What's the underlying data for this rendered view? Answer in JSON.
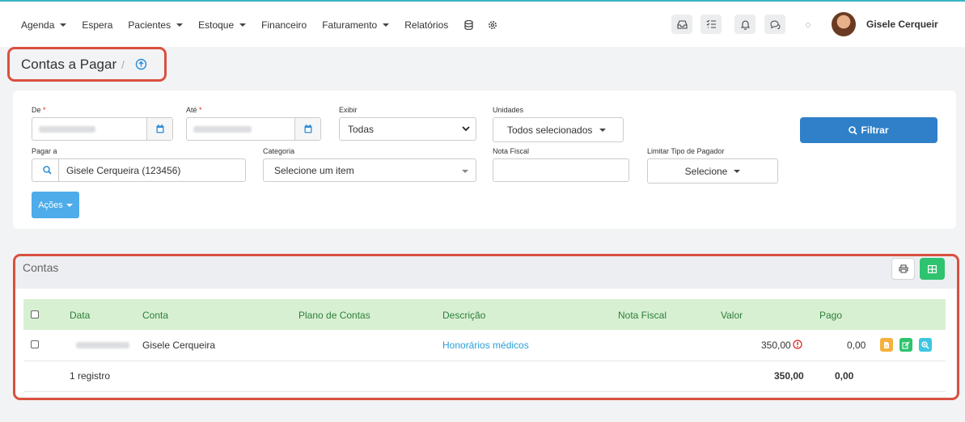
{
  "nav": {
    "items": [
      {
        "label": "Agenda",
        "caret": true
      },
      {
        "label": "Espera",
        "caret": false
      },
      {
        "label": "Pacientes",
        "caret": true
      },
      {
        "label": "Estoque",
        "caret": true
      },
      {
        "label": "Financeiro",
        "caret": false
      },
      {
        "label": "Faturamento",
        "caret": true
      },
      {
        "label": "Relatórios",
        "caret": false
      }
    ],
    "icons": [
      "database-icon",
      "gear-icon"
    ],
    "toolbar_icons": [
      "inbox-icon",
      "checklist-icon",
      "bell-icon",
      "chat-icon"
    ],
    "user_name": "Gisele Cerqueir"
  },
  "breadcrumb": {
    "title": "Contas a Pagar",
    "separator": "/"
  },
  "filters": {
    "de_label": "De",
    "ate_label": "Até",
    "exibir_label": "Exibir",
    "exibir_value": "Todas",
    "unidades_label": "Unidades",
    "unidades_value": "Todos selecionados",
    "pagar_a_label": "Pagar a",
    "pagar_a_value": "Gisele Cerqueira (123456)",
    "categoria_label": "Categoria",
    "categoria_placeholder": "Selecione um item",
    "nota_fiscal_label": "Nota Fiscal",
    "nota_fiscal_value": "",
    "limitar_label": "Limitar Tipo de Pagador",
    "limitar_value": "Selecione",
    "filter_button": "Filtrar",
    "acoes_button": "Ações"
  },
  "table": {
    "title": "Contas",
    "columns": [
      "Data",
      "Conta",
      "Plano de Contas",
      "Descrição",
      "Nota Fiscal",
      "Valor",
      "Pago"
    ],
    "rows": [
      {
        "data": "",
        "conta": "Gisele Cerqueira",
        "plano": "",
        "descricao": "Honorários médicos",
        "nota_fiscal": "",
        "valor": "350,00",
        "pago": "0,00"
      }
    ],
    "footer": {
      "count": "1 registro",
      "valor_total": "350,00",
      "pago_total": "0,00"
    }
  },
  "colors": {
    "accent": "#3bb6c4",
    "primary": "#2f80c8",
    "success": "#2ec36e",
    "header_green": "#d7f0d2",
    "highlight": "#d9503f",
    "link": "#2a9fd6"
  }
}
